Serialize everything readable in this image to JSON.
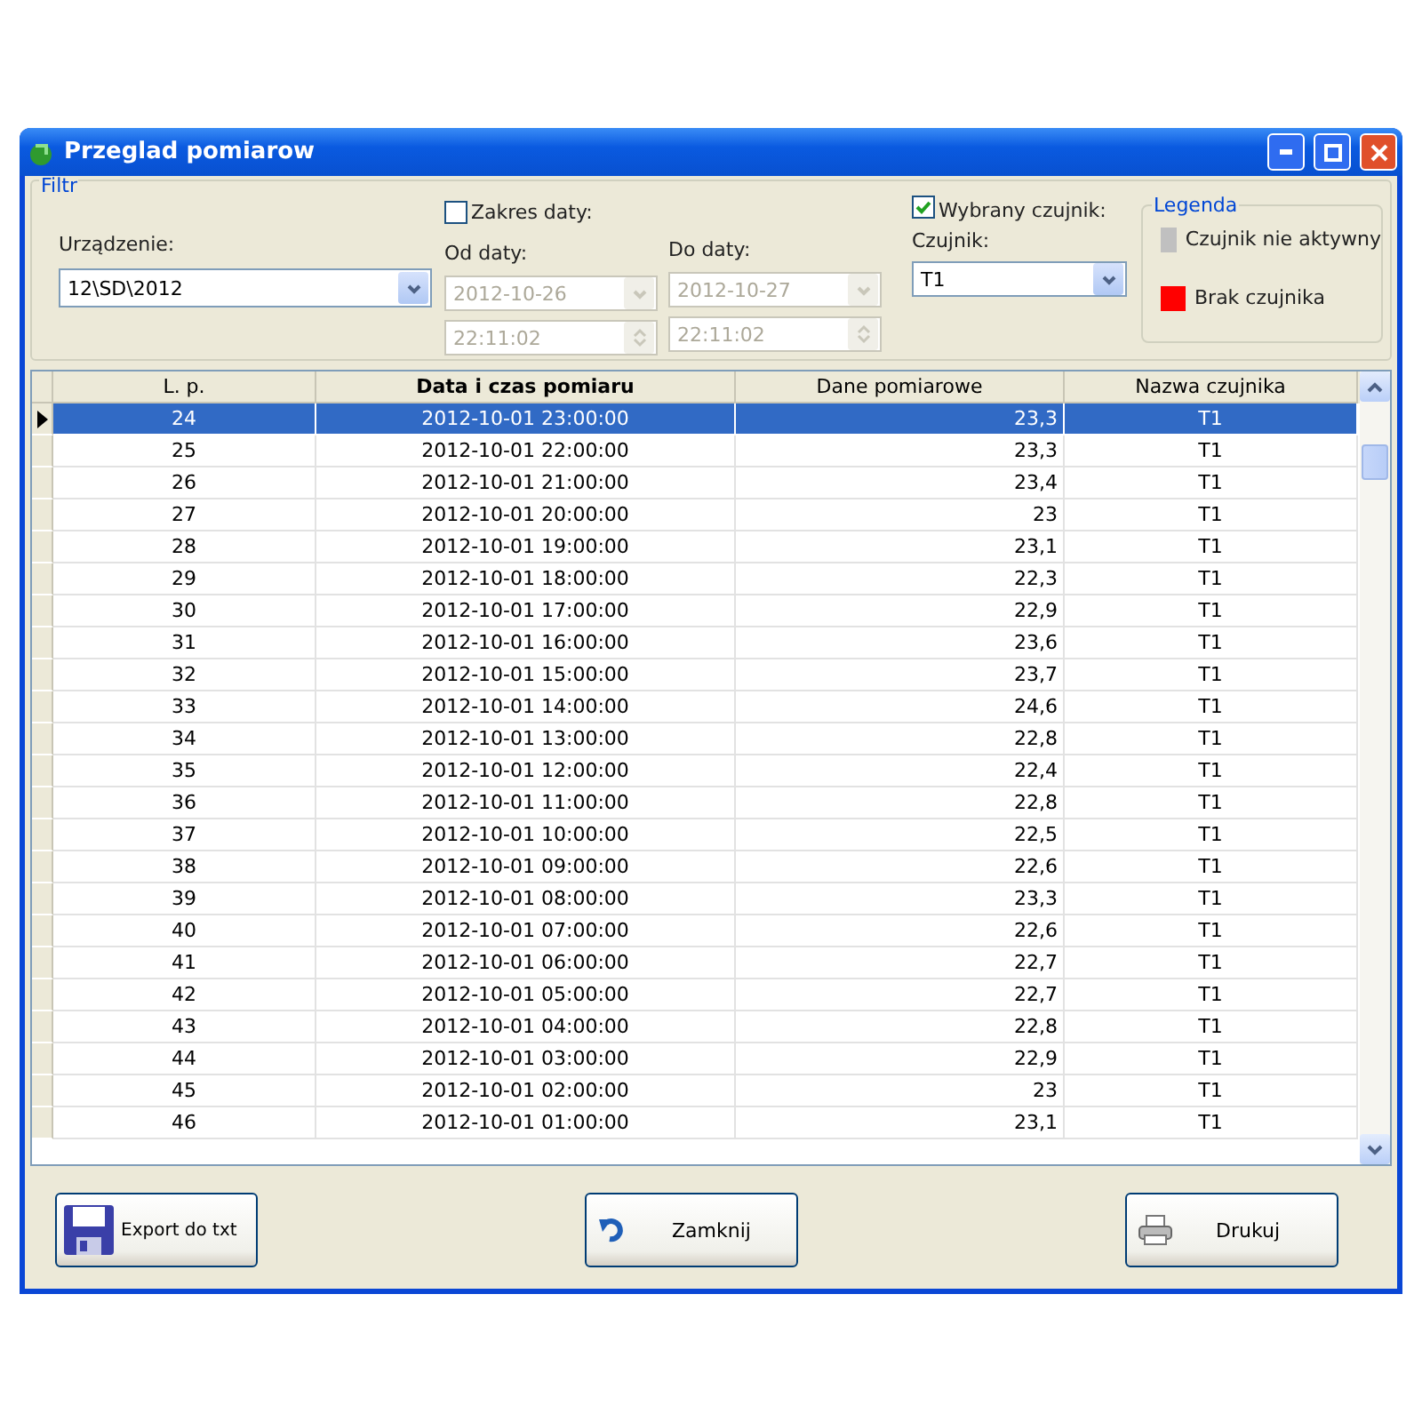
{
  "window": {
    "title": "Przeglad pomiarow"
  },
  "filter": {
    "title": "Filtr",
    "device": {
      "label": "Urządzenie:",
      "value": "12\\SD\\2012"
    },
    "date_range": {
      "label": "Zakres daty:",
      "checked": false
    },
    "from": {
      "label": "Od daty:",
      "date": "2012-10-26",
      "time": "22:11:02",
      "disabled": true
    },
    "to": {
      "label": "Do daty:",
      "date": "2012-10-27",
      "time": "22:11:02",
      "disabled": true
    },
    "sensor_filter": {
      "label": "Wybrany czujnik:",
      "checked": true
    },
    "sensor": {
      "label": "Czujnik:",
      "value": "T1"
    }
  },
  "legend": {
    "title": "Legenda",
    "items": [
      {
        "label": "Czujnik nie aktywny",
        "color": "#c0c0c0"
      },
      {
        "label": "Brak czujnika",
        "color": "#ff0000"
      }
    ]
  },
  "table": {
    "columns": [
      {
        "label": "L. p.",
        "sorted": false
      },
      {
        "label": "Data i czas pomiaru",
        "sorted": true
      },
      {
        "label": "Dane pomiarowe",
        "sorted": false
      },
      {
        "label": "Nazwa czujnika",
        "sorted": false
      }
    ],
    "rows": [
      {
        "cells": [
          "24",
          "2012-10-01 23:00:00",
          "23,3",
          "T1"
        ],
        "selected": true
      },
      {
        "cells": [
          "25",
          "2012-10-01 22:00:00",
          "23,3",
          "T1"
        ],
        "selected": false
      },
      {
        "cells": [
          "26",
          "2012-10-01 21:00:00",
          "23,4",
          "T1"
        ],
        "selected": false
      },
      {
        "cells": [
          "27",
          "2012-10-01 20:00:00",
          "23",
          "T1"
        ],
        "selected": false
      },
      {
        "cells": [
          "28",
          "2012-10-01 19:00:00",
          "23,1",
          "T1"
        ],
        "selected": false
      },
      {
        "cells": [
          "29",
          "2012-10-01 18:00:00",
          "22,3",
          "T1"
        ],
        "selected": false
      },
      {
        "cells": [
          "30",
          "2012-10-01 17:00:00",
          "22,9",
          "T1"
        ],
        "selected": false
      },
      {
        "cells": [
          "31",
          "2012-10-01 16:00:00",
          "23,6",
          "T1"
        ],
        "selected": false
      },
      {
        "cells": [
          "32",
          "2012-10-01 15:00:00",
          "23,7",
          "T1"
        ],
        "selected": false
      },
      {
        "cells": [
          "33",
          "2012-10-01 14:00:00",
          "24,6",
          "T1"
        ],
        "selected": false
      },
      {
        "cells": [
          "34",
          "2012-10-01 13:00:00",
          "22,8",
          "T1"
        ],
        "selected": false
      },
      {
        "cells": [
          "35",
          "2012-10-01 12:00:00",
          "22,4",
          "T1"
        ],
        "selected": false
      },
      {
        "cells": [
          "36",
          "2012-10-01 11:00:00",
          "22,8",
          "T1"
        ],
        "selected": false
      },
      {
        "cells": [
          "37",
          "2012-10-01 10:00:00",
          "22,5",
          "T1"
        ],
        "selected": false
      },
      {
        "cells": [
          "38",
          "2012-10-01 09:00:00",
          "22,6",
          "T1"
        ],
        "selected": false
      },
      {
        "cells": [
          "39",
          "2012-10-01 08:00:00",
          "23,3",
          "T1"
        ],
        "selected": false
      },
      {
        "cells": [
          "40",
          "2012-10-01 07:00:00",
          "22,6",
          "T1"
        ],
        "selected": false
      },
      {
        "cells": [
          "41",
          "2012-10-01 06:00:00",
          "22,7",
          "T1"
        ],
        "selected": false
      },
      {
        "cells": [
          "42",
          "2012-10-01 05:00:00",
          "22,7",
          "T1"
        ],
        "selected": false
      },
      {
        "cells": [
          "43",
          "2012-10-01 04:00:00",
          "22,8",
          "T1"
        ],
        "selected": false
      },
      {
        "cells": [
          "44",
          "2012-10-01 03:00:00",
          "22,9",
          "T1"
        ],
        "selected": false
      },
      {
        "cells": [
          "45",
          "2012-10-01 02:00:00",
          "23",
          "T1"
        ],
        "selected": false
      },
      {
        "cells": [
          "46",
          "2012-10-01 01:00:00",
          "23,1",
          "T1"
        ],
        "selected": false
      }
    ]
  },
  "buttons": [
    {
      "label": "Export do txt",
      "kind": "save"
    },
    {
      "label": "Zamknij",
      "kind": "undo"
    },
    {
      "label": "Drukuj",
      "kind": "print"
    }
  ]
}
